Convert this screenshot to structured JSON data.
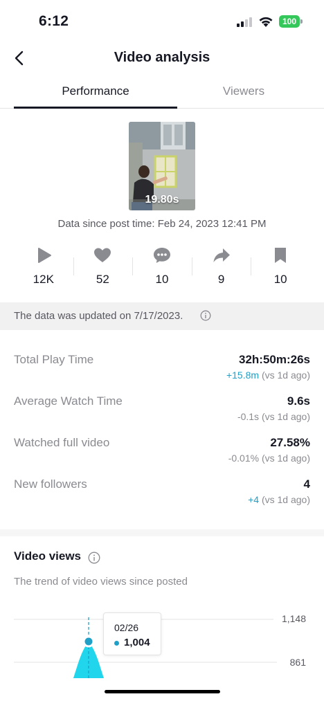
{
  "status_bar": {
    "time": "6:12",
    "battery": "100"
  },
  "nav": {
    "title": "Video analysis"
  },
  "tabs": [
    {
      "label": "Performance",
      "active": true
    },
    {
      "label": "Viewers",
      "active": false
    }
  ],
  "video": {
    "duration": "19.80s",
    "data_since": "Data since post time: Feb 24, 2023 12:41 PM"
  },
  "stats": [
    {
      "icon": "play-icon",
      "value": "12K"
    },
    {
      "icon": "heart-icon",
      "value": "52"
    },
    {
      "icon": "comment-icon",
      "value": "10"
    },
    {
      "icon": "share-icon",
      "value": "9"
    },
    {
      "icon": "bookmark-icon",
      "value": "10"
    }
  ],
  "update_banner": {
    "text": "The data was updated on 7/17/2023."
  },
  "metrics": [
    {
      "label": "Total Play Time",
      "value": "32h:50m:26s",
      "delta_num": "+15.8m",
      "delta_rest": " (vs 1d ago)",
      "delta_positive": true
    },
    {
      "label": "Average Watch Time",
      "value": "9.6s",
      "delta_num": "-0.1s",
      "delta_rest": " (vs 1d ago)",
      "delta_positive": false
    },
    {
      "label": "Watched full video",
      "value": "27.58%",
      "delta_num": "-0.01%",
      "delta_rest": " (vs 1d ago)",
      "delta_positive": false
    },
    {
      "label": "New followers",
      "value": "4",
      "delta_num": "+4",
      "delta_rest": " (vs 1d ago)",
      "delta_positive": true
    }
  ],
  "video_views": {
    "title": "Video views",
    "subtitle": "The trend of video views since posted"
  },
  "chart_data": {
    "type": "area",
    "y_ticks": [
      "1,148",
      "861"
    ],
    "tooltip": {
      "date": "02/26",
      "value": "1,004"
    },
    "points": [
      {
        "x": "02/26",
        "y": 1004
      }
    ],
    "color": "#20d5ec"
  },
  "colors": {
    "accent": "#20a0c7",
    "chart_fill": "#20d5ec",
    "battery": "#34c759"
  }
}
